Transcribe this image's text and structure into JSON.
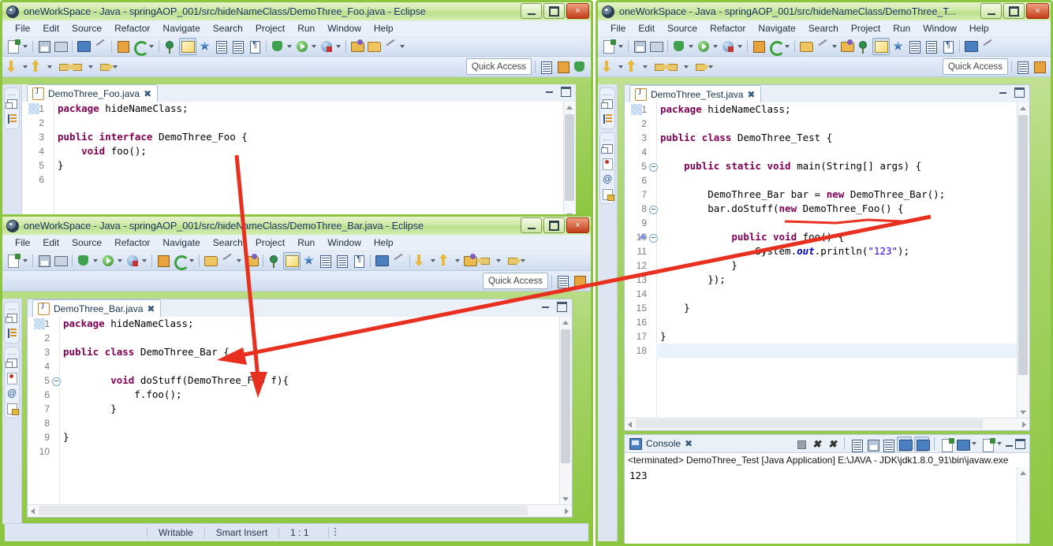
{
  "windows": {
    "foo": {
      "title": "oneWorkSpace - Java - springAOP_001/src/hideNameClass/DemoThree_Foo.java - Eclipse",
      "menu": [
        "File",
        "Edit",
        "Source",
        "Refactor",
        "Navigate",
        "Search",
        "Project",
        "Run",
        "Window",
        "Help"
      ],
      "quick_access": "Quick Access",
      "tab": "DemoThree_Foo.java",
      "code": [
        {
          "n": "1",
          "t": "package hideNameClass;",
          "kw": [
            "package"
          ]
        },
        {
          "n": "2",
          "t": ""
        },
        {
          "n": "3",
          "t": "public interface DemoThree_Foo {",
          "kw": [
            "public",
            "interface"
          ]
        },
        {
          "n": "4",
          "t": "    void foo();",
          "kw": [
            "void"
          ]
        },
        {
          "n": "5",
          "t": "}"
        },
        {
          "n": "6",
          "t": ""
        }
      ]
    },
    "bar": {
      "title": "oneWorkSpace - Java - springAOP_001/src/hideNameClass/DemoThree_Bar.java - Eclipse",
      "menu": [
        "File",
        "Edit",
        "Source",
        "Refactor",
        "Navigate",
        "Search",
        "Project",
        "Run",
        "Window",
        "Help"
      ],
      "quick_access": "Quick Access",
      "tab": "DemoThree_Bar.java",
      "code": [
        {
          "n": "1",
          "t": "package hideNameClass;"
        },
        {
          "n": "2",
          "t": ""
        },
        {
          "n": "3",
          "t": "public class DemoThree_Bar {"
        },
        {
          "n": "4",
          "t": ""
        },
        {
          "n": "5",
          "t": "        void doStuff(DemoThree_Foo f){",
          "fold": true
        },
        {
          "n": "6",
          "t": "            f.foo();"
        },
        {
          "n": "7",
          "t": "        }"
        },
        {
          "n": "8",
          "t": ""
        },
        {
          "n": "9",
          "t": "}"
        },
        {
          "n": "10",
          "t": ""
        }
      ],
      "status": {
        "writable": "Writable",
        "insert": "Smart Insert",
        "position": "1 : 1"
      }
    },
    "test": {
      "title": "oneWorkSpace - Java - springAOP_001/src/hideNameClass/DemoThree_T...",
      "menu": [
        "File",
        "Edit",
        "Source",
        "Refactor",
        "Navigate",
        "Search",
        "Project",
        "Run",
        "Window",
        "Help"
      ],
      "quick_access": "Quick Access",
      "tab": "DemoThree_Test.java",
      "code": [
        {
          "n": "1",
          "t": "package hideNameClass;"
        },
        {
          "n": "2",
          "t": ""
        },
        {
          "n": "3",
          "t": "public class DemoThree_Test {"
        },
        {
          "n": "4",
          "t": ""
        },
        {
          "n": "5",
          "t": "    public static void main(String[] args) {",
          "fold": true
        },
        {
          "n": "6",
          "t": ""
        },
        {
          "n": "7",
          "t": "        DemoThree_Bar bar = new DemoThree_Bar();"
        },
        {
          "n": "8",
          "t": "        bar.doStuff(new DemoThree_Foo() {",
          "fold": true
        },
        {
          "n": "9",
          "t": ""
        },
        {
          "n": "10",
          "t": "            public void foo() {",
          "fold": true,
          "warn": true
        },
        {
          "n": "11",
          "t": "                System.out.println(\"123\");"
        },
        {
          "n": "12",
          "t": "            }"
        },
        {
          "n": "13",
          "t": "        });"
        },
        {
          "n": "14",
          "t": ""
        },
        {
          "n": "15",
          "t": "    }"
        },
        {
          "n": "16",
          "t": ""
        },
        {
          "n": "17",
          "t": "}"
        },
        {
          "n": "18",
          "t": ""
        }
      ],
      "console": {
        "tab": "Console",
        "info": "<terminated> DemoThree_Test [Java Application] E:\\JAVA - JDK\\jdk1.8.0_91\\bin\\javaw.exe",
        "output": "123"
      }
    }
  },
  "window_buttons": {
    "minimize": "minimize",
    "maximize": "maximize",
    "close": "×"
  },
  "colors": {
    "title_green": "#8cc63f",
    "keyword": "#7f0055",
    "string": "#2a00ff",
    "field": "#0000c0",
    "annotation_red": "#e83020",
    "toolbar": "#cfddf0"
  }
}
